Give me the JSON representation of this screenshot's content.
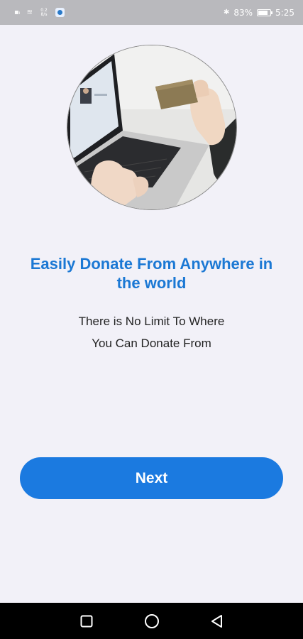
{
  "status_bar": {
    "network_top": "0.2",
    "network_bottom": "8/s",
    "battery_percent": "83%",
    "battery_level": 0.83,
    "time": "5:25",
    "icons": [
      "sim-icon",
      "wifi-icon",
      "network-speed",
      "app-notification-icon",
      "bluetooth-icon",
      "battery-icon"
    ]
  },
  "onboarding": {
    "title": "Easily Donate From Anywhere in the world",
    "subtitle_line1": "There is No Limit To Where",
    "subtitle_line2": "You Can Donate From",
    "next_label": "Next"
  },
  "nav_bar": {
    "icons": [
      "square-recents-icon",
      "circle-home-icon",
      "triangle-back-icon"
    ]
  },
  "colors": {
    "accent": "#1b7ae0",
    "title": "#1b78d4",
    "background": "#f2f1f8",
    "status_bar": "#b9b9bd",
    "nav_bar": "#000000"
  }
}
